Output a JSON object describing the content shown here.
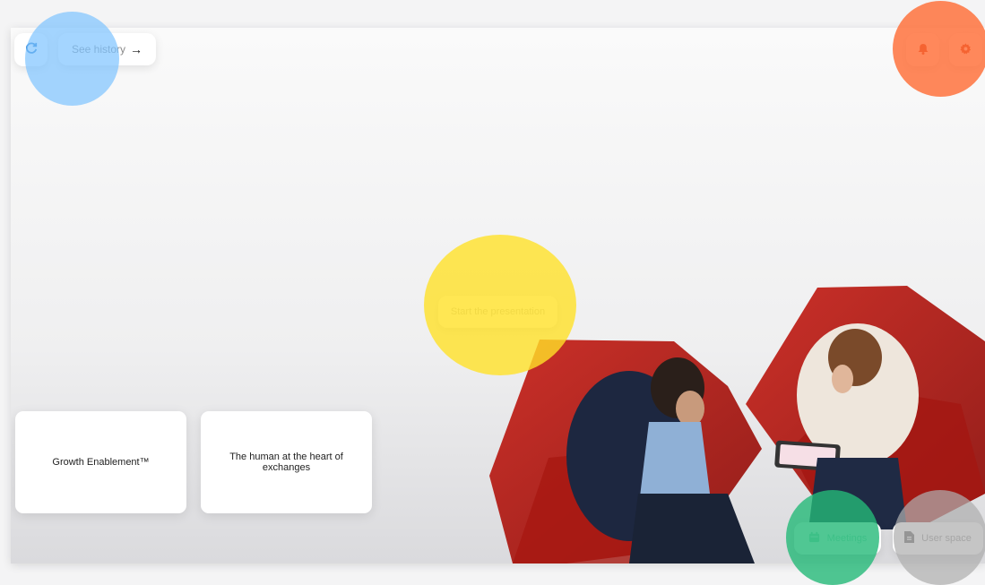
{
  "toolbar": {
    "refresh_icon": "refresh-icon",
    "history_label": "See history",
    "history_arrow": "→",
    "bell_icon": "bell-icon",
    "gear_icon": "gear-icon"
  },
  "main": {
    "start_label": "Start the presentation"
  },
  "cards": [
    {
      "label": "Growth Enablement™"
    },
    {
      "label": "The human at the heart of exchanges"
    }
  ],
  "bottom_actions": {
    "meetings_label": "Meetings",
    "meetings_icon": "calendar-icon",
    "user_space_label": "User space",
    "user_space_icon": "document-icon"
  },
  "colors": {
    "accent_blue": "#7dc3ff",
    "accent_orange": "#ff6e37",
    "accent_yellow": "#ffe128",
    "accent_green": "#24b978",
    "neutral_gray": "#afafaf"
  }
}
